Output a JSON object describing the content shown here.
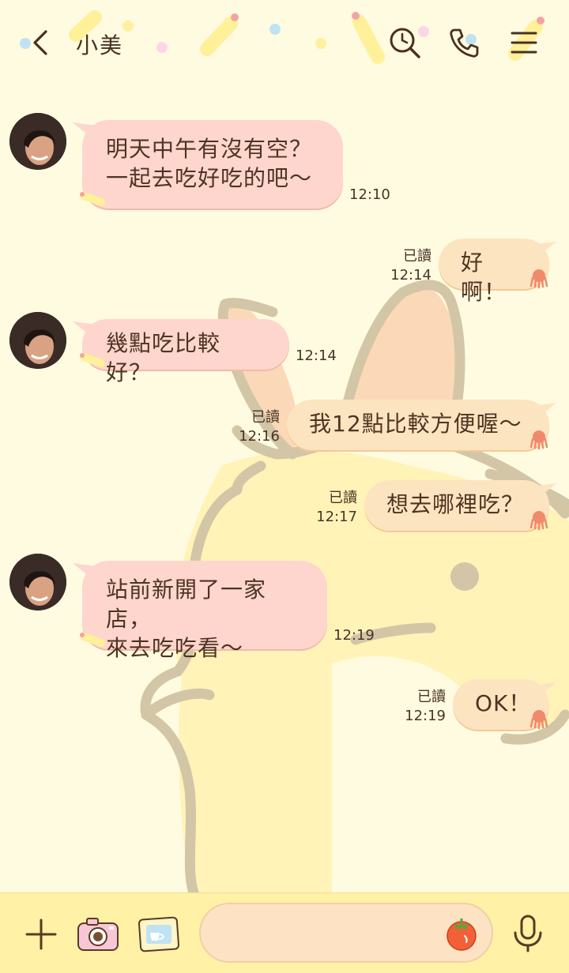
{
  "header": {
    "title": "小美"
  },
  "messages": [
    {
      "side": "in",
      "text": "明天中午有沒有空？\n一起去吃好吃的吧～",
      "time": "12:10"
    },
    {
      "side": "out",
      "text": "好啊！",
      "time": "12:14",
      "read": "已讀"
    },
    {
      "side": "in",
      "text": "幾點吃比較好？",
      "time": "12:14"
    },
    {
      "side": "out",
      "text": "我12點比較方便喔～",
      "time": "12:16",
      "read": "已讀"
    },
    {
      "side": "out",
      "text": "想去哪裡吃？",
      "time": "12:17",
      "read": "已讀"
    },
    {
      "side": "in",
      "text": "站前新開了一家店，\n來去吃吃看～",
      "time": "12:19"
    },
    {
      "side": "out",
      "text": "OK！",
      "time": "12:19",
      "read": "已讀"
    }
  ],
  "footer": {
    "input_value": ""
  },
  "icons": {
    "back": "back-chevron-icon",
    "search": "search-clock-icon",
    "call": "phone-icon",
    "menu": "menu-icon",
    "plus": "plus-icon",
    "camera": "camera-icon",
    "gallery": "image-icon",
    "sticker": "tomato-sticker-icon",
    "mic": "microphone-icon"
  },
  "colors": {
    "background": "#fffbe0",
    "bubble_in": "#fed6cd",
    "bubble_out": "#fde4c0",
    "footer": "#fff1a6",
    "text": "#4e3422"
  }
}
